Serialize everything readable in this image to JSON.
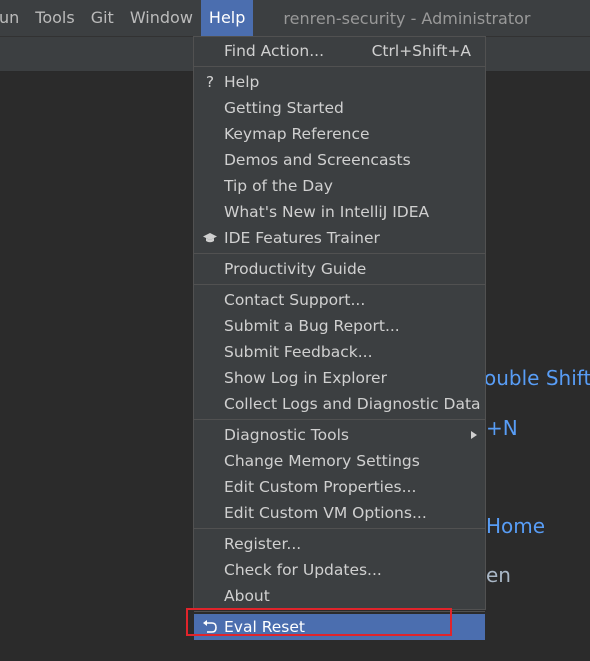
{
  "menubar": {
    "items": [
      "un",
      "Tools",
      "Git",
      "Window",
      "Help"
    ],
    "title": "renren-security - Administrator"
  },
  "background": {
    "shortcut1": "ouble Shift",
    "shortcut2": "+N",
    "shortcut3": "Home",
    "shortcut4": "en"
  },
  "help_menu": {
    "find_action": {
      "label": "Find Action...",
      "shortcut": "Ctrl+Shift+A"
    },
    "help": "Help",
    "help_icon": "question-icon",
    "getting_started": "Getting Started",
    "keymap_reference": "Keymap Reference",
    "demos": "Demos and Screencasts",
    "tip_of_day": "Tip of the Day",
    "whats_new": "What's New in IntelliJ IDEA",
    "features_trainer": "IDE Features Trainer",
    "features_trainer_icon": "graduation-cap-icon",
    "productivity_guide": "Productivity Guide",
    "contact_support": "Contact Support...",
    "submit_bug": "Submit a Bug Report...",
    "submit_feedback": "Submit Feedback...",
    "show_log": "Show Log in Explorer",
    "collect_logs": "Collect Logs and Diagnostic Data",
    "diagnostic_tools": "Diagnostic Tools",
    "change_memory": "Change Memory Settings",
    "edit_properties": "Edit Custom Properties...",
    "edit_vm_options": "Edit Custom VM Options...",
    "register": "Register...",
    "check_updates": "Check for Updates...",
    "about": "About",
    "eval_reset": "Eval Reset",
    "eval_reset_icon": "undo-icon"
  },
  "colors": {
    "selection": "#4b6eaf",
    "highlight_box": "#e0242b",
    "link_blue": "#589df6"
  }
}
